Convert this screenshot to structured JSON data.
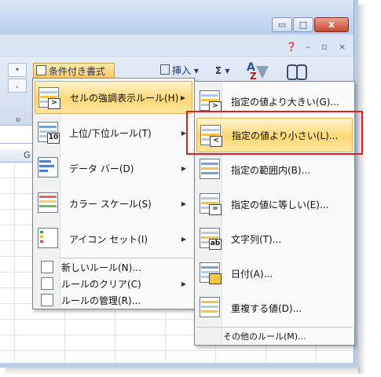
{
  "window": {
    "min_glyph": "▭",
    "restore_glyph": "□",
    "close_glyph": "x"
  },
  "mdi": {
    "help": "❓",
    "minimize": "–",
    "restore": "▫",
    "close": "×"
  },
  "ribbon": {
    "conditional_formatting": "条件付き書式 ▾",
    "insert": "挿入 ▾",
    "sigma": "Σ ▾",
    "col_letter": "G"
  },
  "main_menu": {
    "items": [
      {
        "label": "セルの強調表示ルール(H)",
        "has_sub": true
      },
      {
        "label": "上位/下位ルール(T)",
        "has_sub": true,
        "badge": "10"
      },
      {
        "label": "データ バー(D)",
        "has_sub": true
      },
      {
        "label": "カラー スケール(S)",
        "has_sub": true
      },
      {
        "label": "アイコン セット(I)",
        "has_sub": true
      }
    ],
    "small_items": [
      {
        "label": "新しいルール(N)..."
      },
      {
        "label": "ルールのクリア(C)",
        "has_sub": true
      },
      {
        "label": "ルールの管理(R)..."
      }
    ]
  },
  "sub_menu": {
    "items": [
      {
        "label": "指定の値より大きい(G)...",
        "badge": ">"
      },
      {
        "label": "指定の値より小さい(L)...",
        "badge": "<"
      },
      {
        "label": "指定の範囲内(B)..."
      },
      {
        "label": "指定の値に等しい(E)...",
        "badge": "="
      },
      {
        "label": "文字列(T)...",
        "badge": "ab"
      },
      {
        "label": "日付(A)..."
      },
      {
        "label": "重複する値(D)..."
      }
    ],
    "other": "その他のルール(M)..."
  },
  "colors": {
    "highlight": "#ffd875",
    "annotation_red": "#e02020"
  }
}
